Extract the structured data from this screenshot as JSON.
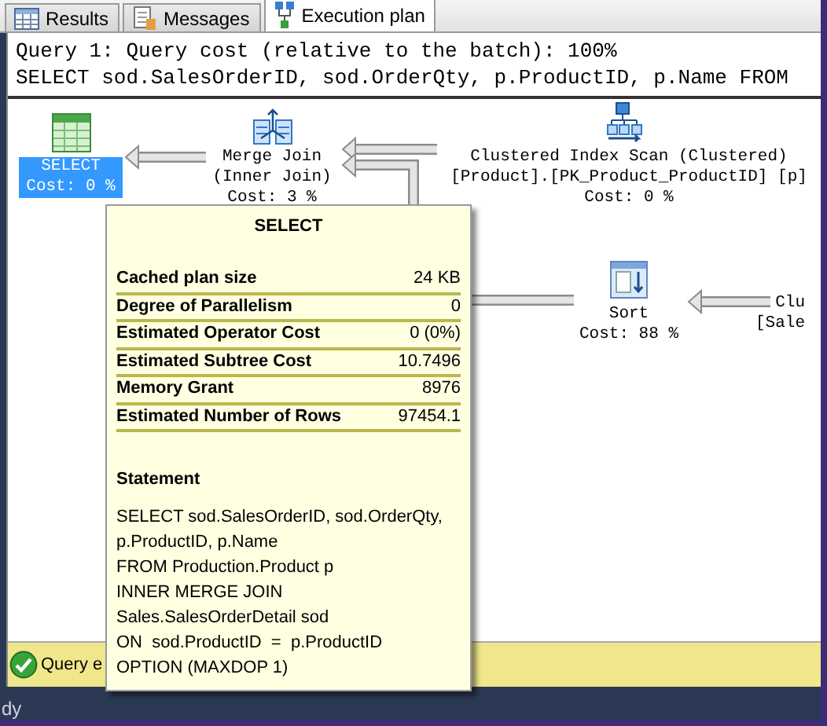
{
  "tabs": [
    {
      "label": "Results",
      "kind": "grid",
      "selected": false
    },
    {
      "label": "Messages",
      "kind": "doc",
      "selected": false
    },
    {
      "label": "Execution plan",
      "kind": "plan",
      "selected": true
    }
  ],
  "query": {
    "header": "Query 1: Query cost (relative to the batch): 100%",
    "statement": "SELECT sod.SalesOrderID, sod.OrderQty, p.ProductID, p.Name FROM"
  },
  "plan": {
    "nodes": [
      {
        "kind": "select",
        "selected": true,
        "lines": [
          "SELECT",
          "Cost: 0 %"
        ]
      },
      {
        "kind": "merge",
        "selected": false,
        "lines": [
          "Merge Join",
          "(Inner Join)",
          "Cost: 3 %"
        ]
      },
      {
        "kind": "scan",
        "selected": false,
        "lines": [
          "Clustered Index Scan (Clustered)",
          "[Product].[PK_Product_ProductID] [p]",
          "Cost: 0 %"
        ]
      },
      {
        "kind": "sort",
        "selected": false,
        "lines": [
          "Sort",
          "Cost: 88 %"
        ]
      },
      {
        "kind": "partial",
        "selected": false,
        "lines": [
          "Clu",
          "[Sale"
        ]
      }
    ]
  },
  "tooltip": {
    "title": "SELECT",
    "properties": [
      {
        "name": "Cached plan size",
        "value": "24 KB"
      },
      {
        "name": "Degree of Parallelism",
        "value": "0"
      },
      {
        "name": "Estimated Operator Cost",
        "value": "0 (0%)"
      },
      {
        "name": "Estimated Subtree Cost",
        "value": "10.7496"
      },
      {
        "name": "Memory Grant",
        "value": "8976"
      },
      {
        "name": "Estimated Number of Rows",
        "value": "97454.1"
      }
    ],
    "statement_heading": "Statement",
    "statement": "SELECT sod.SalesOrderID, sod.OrderQty,\np.ProductID, p.Name\nFROM Production.Product p\nINNER MERGE JOIN\nSales.SalesOrderDetail sod\nON  sod.ProductID  =  p.ProductID\nOPTION (MAXDOP 1)"
  },
  "status_bar": {
    "message": "Query e"
  },
  "footer": {
    "text": "dy"
  }
}
